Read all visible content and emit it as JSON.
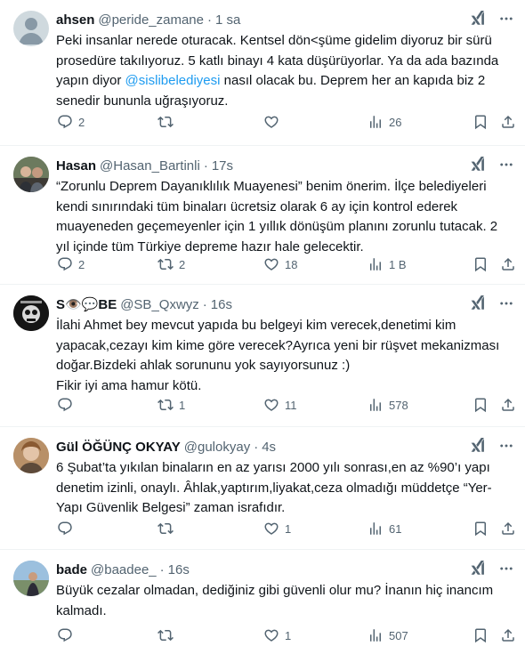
{
  "tweets": [
    {
      "name": "ahsen",
      "handle": "@peride_zamane",
      "time": "1 sa",
      "text_before": "Peki insanlar nerede oturacak. Kentsel dön<şüme gidelim diyoruz bir sürü prosedüre takılıyoruz. 5 katlı binayı 4 kata düşürüyorlar. Ya da ada bazında yapın diyor ",
      "mention": "@sislibelediyesi",
      "text_after": "  nasıl olacak bu. Deprem her an kapıda biz 2 senedir bununla uğraşıyoruz.",
      "replies": "2",
      "reposts": "",
      "likes": "",
      "views": "26"
    },
    {
      "name": "Hasan",
      "handle": "@Hasan_Bartinli",
      "time": "17s",
      "text": "“Zorunlu Deprem Dayanıklılık Muayenesi” benim önerim. İlçe belediyeleri kendi sınırındaki tüm binaları ücretsiz olarak 6 ay için kontrol ederek muayeneden geçemeyenler için 1 yıllık dönüşüm planını zorunlu tutacak. 2 yıl içinde tüm Türkiye depreme hazır hale gelecektir.",
      "replies": "2",
      "reposts": "2",
      "likes": "18",
      "views": "1 B"
    },
    {
      "name": "S👁️💬BE",
      "handle": "@SB_Qxwyz",
      "time": "16s",
      "lines": [
        "İlahi Ahmet bey mevcut yapıda bu belgeyi kim verecek,denetimi kim yapacak,cezayı kim kime göre verecek?Ayrıca yeni bir rüşvet mekanizması doğar.Bizdeki ahlak sorununu yok sayıyorsunuz :)",
        "Fikir iyi ama hamur kötü."
      ],
      "replies": "",
      "reposts": "1",
      "likes": "11",
      "views": "578"
    },
    {
      "name": "Gül ÖĞÜNÇ OKYAY",
      "handle": "@gulokyay",
      "time": "4s",
      "text": "6 Şubat’ta yıkılan binaların en az yarısı 2000 yılı sonrası,en az %90’ı yapı denetim izinli, onaylı. Âhlak,yaptırım,liyakat,ceza olmadığı müddetçe “Yer-Yapı Güvenlik Belgesi” zaman israfıdır.",
      "replies": "",
      "reposts": "",
      "likes": "1",
      "views": "61"
    },
    {
      "name": "bade",
      "handle": "@baadee_",
      "time": "16s",
      "text": "Büyük cezalar olmadan, dediğiniz gibi güvenli olur mu? İnanın hiç inancım kalmadı.",
      "replies": "",
      "reposts": "",
      "likes": "1",
      "views": "507"
    }
  ],
  "icons": {
    "reply": "reply-icon",
    "repost": "repost-icon",
    "like": "like-icon",
    "views": "views-icon",
    "bookmark": "bookmark-icon",
    "share": "share-icon",
    "grok": "grok-icon",
    "more": "more-icon"
  },
  "colors": {
    "text": "#0f1419",
    "secondary": "#536471",
    "accent": "#1d9bf0",
    "divider": "#eff3f4"
  }
}
